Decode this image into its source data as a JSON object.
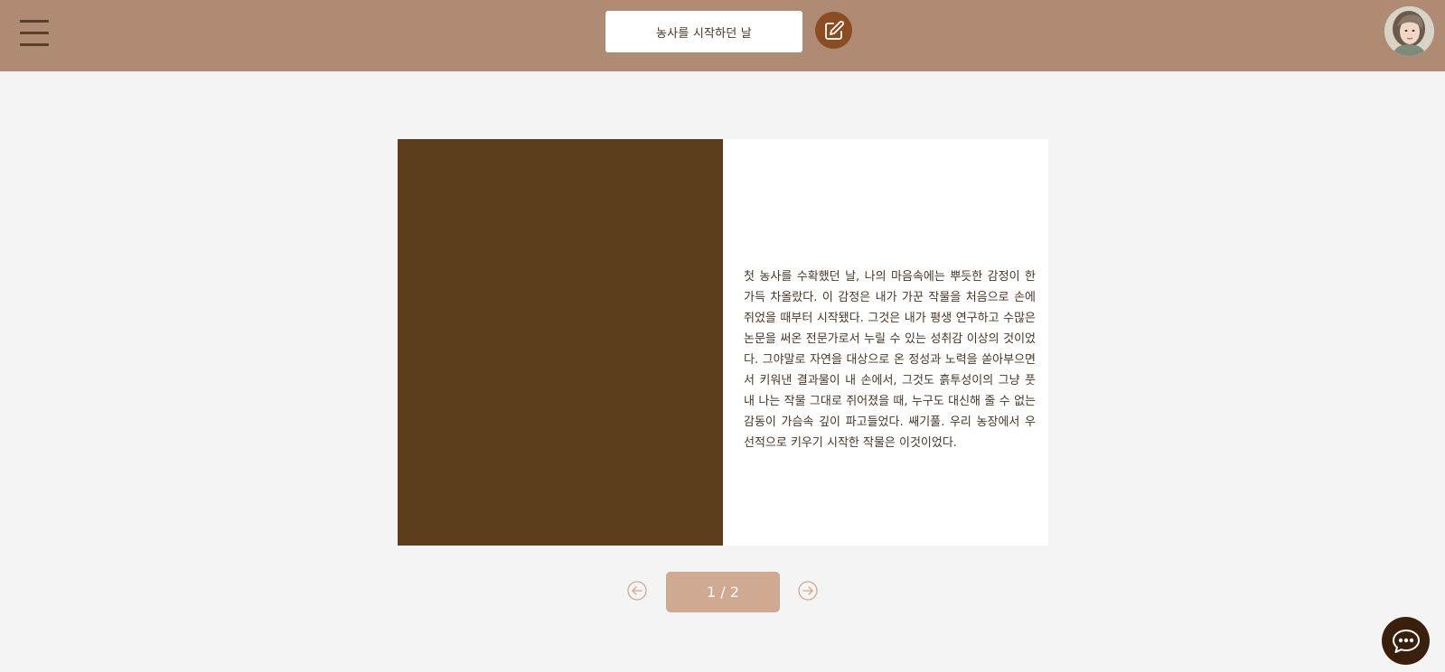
{
  "header": {
    "title": "농사를 시작하던 날",
    "menu_icon": "hamburger-menu-icon",
    "edit_icon": "edit-icon",
    "profile_icon": "avatar"
  },
  "book": {
    "right_page_text": "첫 농사를 수확했던 날, 나의 마음속에는 뿌듯한 감정이 한가득 차올랐다. 이 감정은 내가 가꾼 작물을 처음으로 손에 쥐었을 때부터 시작됐다. 그것은 내가 평생 연구하고 수많은 논문을 써온 전문가로서 누릴 수 있는 성취감 이상의 것이었다. 그야말로 자연을 대상으로 온 정성과 노력을 쏟아부으면서 키워낸 결과물이 내 손에서, 그것도 흙투성이의 그냥 풋내 나는 작물 그대로 쥐어졌을 때, 누구도 대신해 줄 수 없는 감동이 가슴속 깊이 파고들었다.     쌔기풀. 우리 농장에서 우선적으로 키우기 시작한 작물은 이것이었다."
  },
  "pagination": {
    "label": "1 / 2",
    "prev_icon": "arrow-left-circle-icon",
    "next_icon": "arrow-right-circle-icon"
  },
  "chat": {
    "icon": "chat-bubble-icon"
  },
  "colors": {
    "header_bg": "#b08b74",
    "left_page_bg": "#5c3e1d",
    "page_indicator_bg": "#cfa991",
    "edit_button_bg": "#8a4d22",
    "chat_button_bg": "#3a1f0c"
  }
}
